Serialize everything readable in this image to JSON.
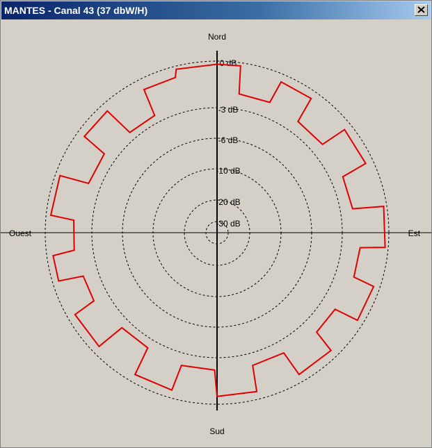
{
  "window": {
    "title": "MANTES - Canal 43 (37 dbW/H)"
  },
  "colors": {
    "pattern": "#e00000",
    "grid": "#000000",
    "background": "#d4d0c8"
  },
  "icons": {
    "close": "close-icon"
  },
  "chart_data": {
    "type": "polar-line",
    "title": "",
    "directions": {
      "north": "Nord",
      "south": "Sud",
      "west": "Ouest",
      "east": "Est"
    },
    "rings": [
      "0 dB",
      "-3 dB",
      "-6 dB",
      "-10 dB",
      "-20 dB",
      "-30 dB"
    ],
    "ring_values_db": [
      0,
      -3,
      -6,
      -10,
      -20,
      -30
    ],
    "series": [
      {
        "azimuth_deg": [
          0,
          8,
          9,
          22,
          23,
          35,
          36,
          50,
          51,
          65,
          66,
          80,
          81,
          95,
          96,
          108,
          109,
          122,
          123,
          135,
          136,
          150,
          151,
          165,
          166,
          180,
          181,
          195,
          196,
          210,
          211,
          225,
          226,
          240,
          241,
          252,
          253,
          262,
          263,
          275,
          276,
          290,
          291,
          305,
          306,
          318,
          319,
          332,
          333,
          345,
          346,
          360
        ],
        "level_db": [
          -0.2,
          -0.2,
          -2.0,
          -2.0,
          -0.5,
          -0.5,
          -2.2,
          -2.2,
          -0.5,
          -0.5,
          -2.2,
          -2.2,
          -0.2,
          -0.2,
          -1.8,
          -1.8,
          -0.4,
          -0.4,
          -2.0,
          -2.0,
          -0.5,
          -0.5,
          -2.2,
          -2.2,
          -0.5,
          -0.5,
          -2.2,
          -2.2,
          -0.5,
          -0.5,
          -2.4,
          -2.4,
          -0.5,
          -0.5,
          -2.0,
          -2.0,
          -0.4,
          -0.4,
          -1.8,
          -1.8,
          -0.3,
          -0.3,
          -2.2,
          -2.2,
          -0.5,
          -0.5,
          -2.5,
          -2.5,
          -0.7,
          -0.7,
          -0.2,
          -0.2
        ]
      }
    ]
  }
}
